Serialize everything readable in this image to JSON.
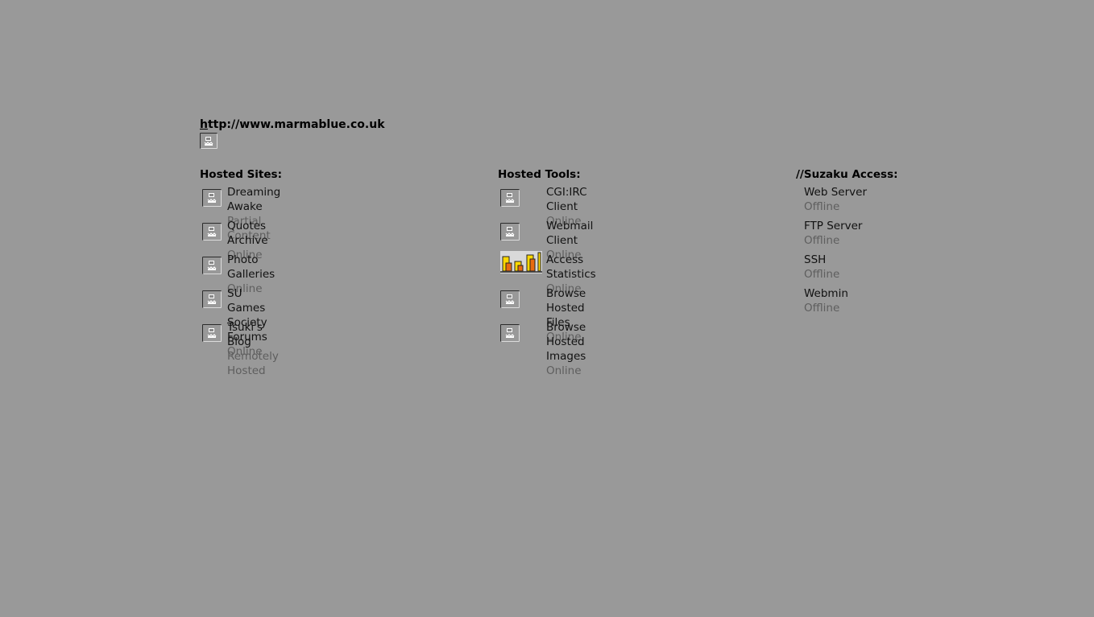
{
  "header": {
    "url": "http://www.marmablue.co.uk",
    "banner_icon": "broken-image-icon"
  },
  "colors": {
    "background": "#999999",
    "text": "#111111",
    "status_text": "#5e5e5e",
    "stats_bar_yellow": "#ffd800",
    "stats_bar_orange": "#e86a10"
  },
  "hosted_sites": {
    "heading": "Hosted Sites:",
    "items": [
      {
        "name": "Dreaming Awake",
        "status": "Partial Content",
        "icon": "broken-image-icon"
      },
      {
        "name": "Quotes Archive",
        "status": "Online",
        "icon": "broken-image-icon"
      },
      {
        "name": "Photo Galleries",
        "status": "Online",
        "icon": "broken-image-icon"
      },
      {
        "name": "SU Games Society Forums",
        "status": "Online",
        "icon": "broken-image-icon"
      },
      {
        "name": "Tsuki's Blog",
        "status": "Remotely Hosted",
        "icon": "broken-image-icon"
      }
    ]
  },
  "hosted_tools": {
    "heading": "Hosted Tools:",
    "items": [
      {
        "name": "CGI:IRC Client",
        "status": "Online",
        "icon": "broken-image-icon"
      },
      {
        "name": "Webmail Client",
        "status": "Online",
        "icon": "broken-image-icon"
      },
      {
        "name": "Access Statistics",
        "status": "Online",
        "icon": "bar-chart-icon"
      },
      {
        "name": "Browse Hosted Files",
        "status": "Online",
        "icon": "broken-image-icon"
      },
      {
        "name": "Browse Hosted Images",
        "status": "Online",
        "icon": "broken-image-icon"
      }
    ]
  },
  "suzaku_access": {
    "heading": "//Suzaku Access:",
    "items": [
      {
        "name": "Web Server",
        "status": "Offline"
      },
      {
        "name": "FTP Server",
        "status": "Offline"
      },
      {
        "name": "SSH",
        "status": "Offline"
      },
      {
        "name": "Webmin",
        "status": "Offline"
      }
    ]
  }
}
